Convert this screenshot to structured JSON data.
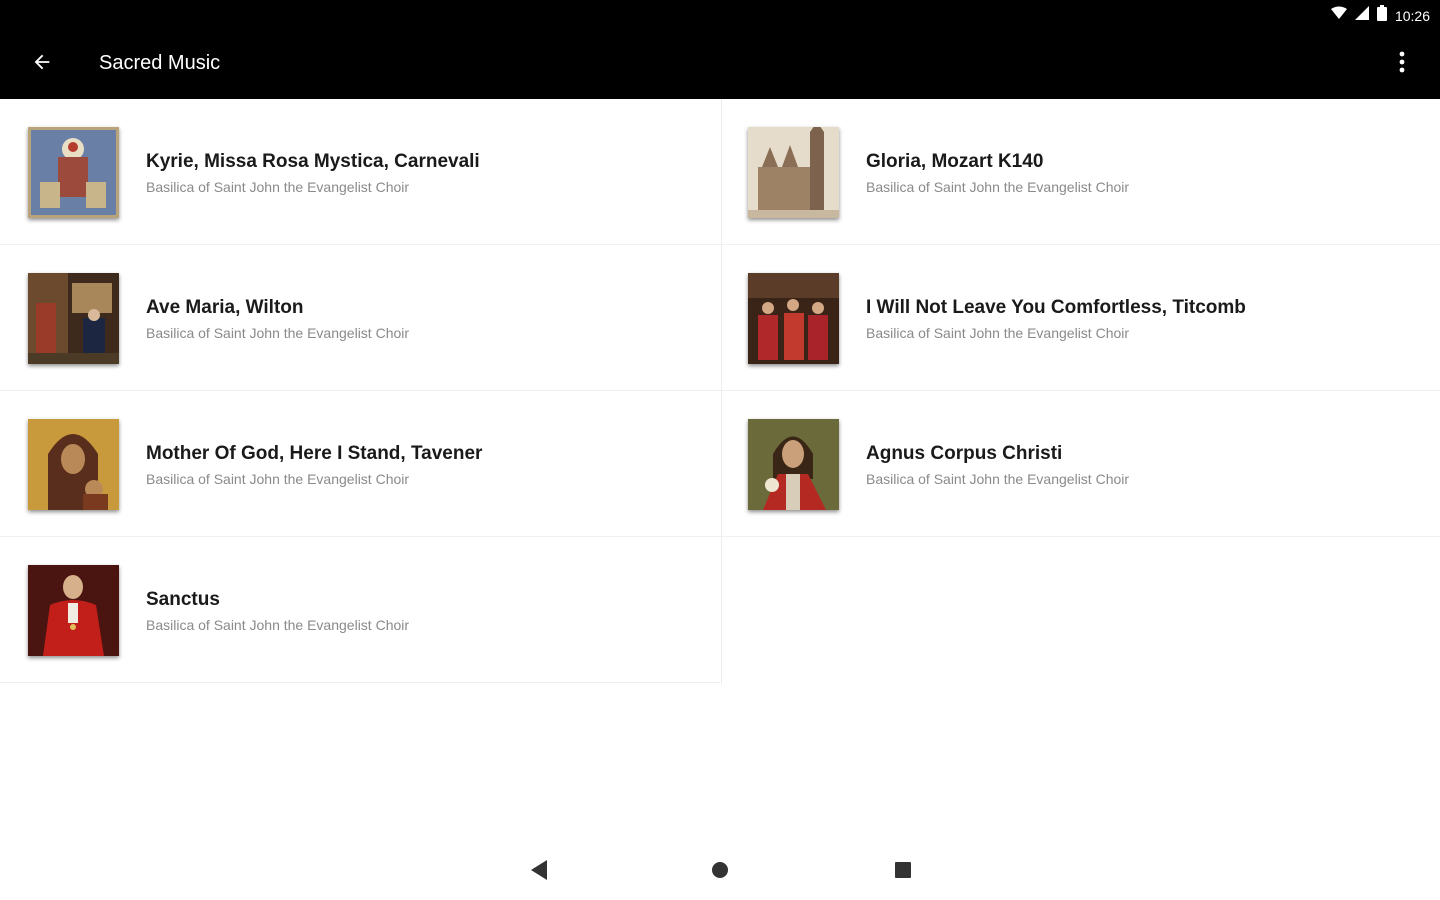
{
  "status_bar": {
    "time": "10:26"
  },
  "app_bar": {
    "title": "Sacred Music"
  },
  "tracks": [
    {
      "title": "Kyrie, Missa Rosa Mystica, Carnevali",
      "subtitle": "Basilica of Saint John the Evangelist Choir",
      "art": "icon-madonna-mosaic"
    },
    {
      "title": "Gloria, Mozart K140",
      "subtitle": "Basilica of Saint John the Evangelist Choir",
      "art": "cathedral-sketch"
    },
    {
      "title": "Ave Maria, Wilton",
      "subtitle": "Basilica of Saint John the Evangelist Choir",
      "art": "annunciation-painting"
    },
    {
      "title": "I Will Not Leave You Comfortless, Titcomb",
      "subtitle": "Basilica of Saint John the Evangelist Choir",
      "art": "pentecost-painting"
    },
    {
      "title": "Mother Of God, Here I Stand, Tavener",
      "subtitle": "Basilica of Saint John the Evangelist Choir",
      "art": "theotokos-icon"
    },
    {
      "title": "Agnus Corpus Christi",
      "subtitle": "Basilica of Saint John the Evangelist Choir",
      "art": "christ-eucharist-painting"
    },
    {
      "title": "Sanctus",
      "subtitle": "Basilica of Saint John the Evangelist Choir",
      "art": "cardinal-portrait"
    }
  ],
  "colors": {
    "app_bar": "#000000",
    "title_text": "#1a1a1a",
    "subtitle_text": "#8a8a8a"
  }
}
